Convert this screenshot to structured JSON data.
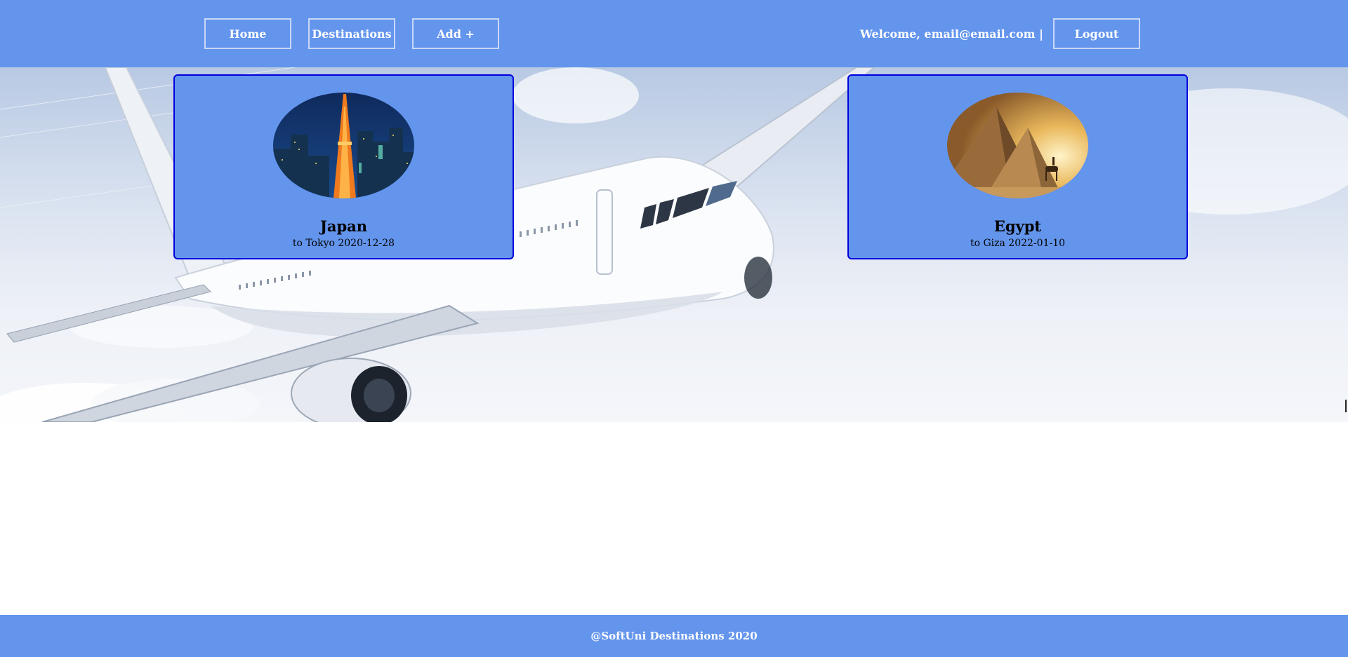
{
  "nav": {
    "home_label": "Home",
    "destinations_label": "Destinations",
    "add_label": "Add +",
    "welcome_text": "Welcome, email@email.com |",
    "logout_label": "Logout"
  },
  "destinations": [
    {
      "name": "Japan",
      "subtitle": "to Tokyo 2020-12-28",
      "image_icon": "tokyo-tower-night-image"
    },
    {
      "name": "Egypt",
      "subtitle": "to Giza 2022-01-10",
      "image_icon": "giza-pyramids-image"
    }
  ],
  "footer": {
    "text": "@SoftUni Destinations 2020"
  },
  "colors": {
    "header_bg": "#6495ED",
    "card_bg": "#6495ED",
    "card_border": "#0000dd",
    "footer_bg": "#6495ED"
  }
}
